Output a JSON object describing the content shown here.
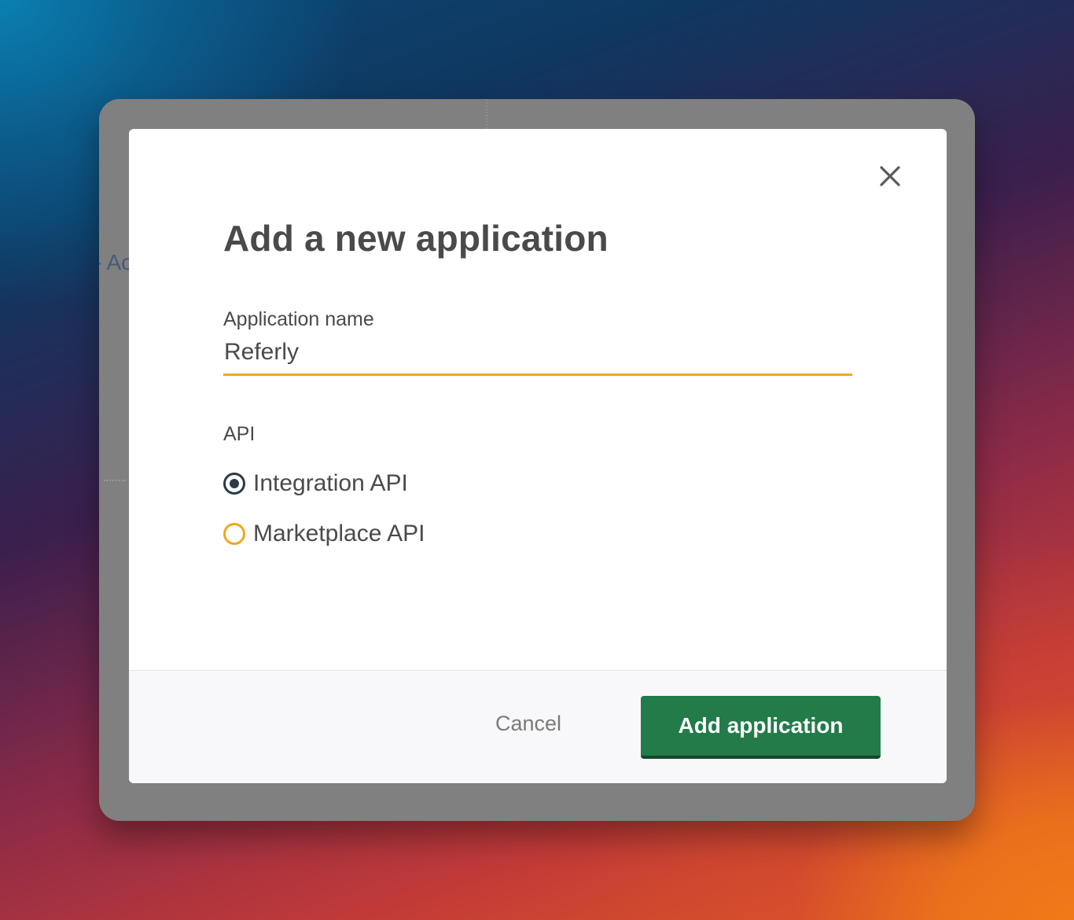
{
  "background": {
    "partial_text": "- Ac"
  },
  "dialog": {
    "title": "Add a new application",
    "close_icon": "close-icon",
    "name_field": {
      "label": "Application name",
      "value": "Referly"
    },
    "api_group": {
      "label": "API",
      "options": [
        {
          "label": "Integration API",
          "selected": true
        },
        {
          "label": "Marketplace API",
          "selected": false
        }
      ]
    },
    "footer": {
      "cancel_label": "Cancel",
      "submit_label": "Add application"
    }
  },
  "colors": {
    "primary_button": "#227b48",
    "focus_accent": "#f0a81a",
    "radio_checked": "#2b3a4a",
    "text": "#4a4a4a"
  }
}
